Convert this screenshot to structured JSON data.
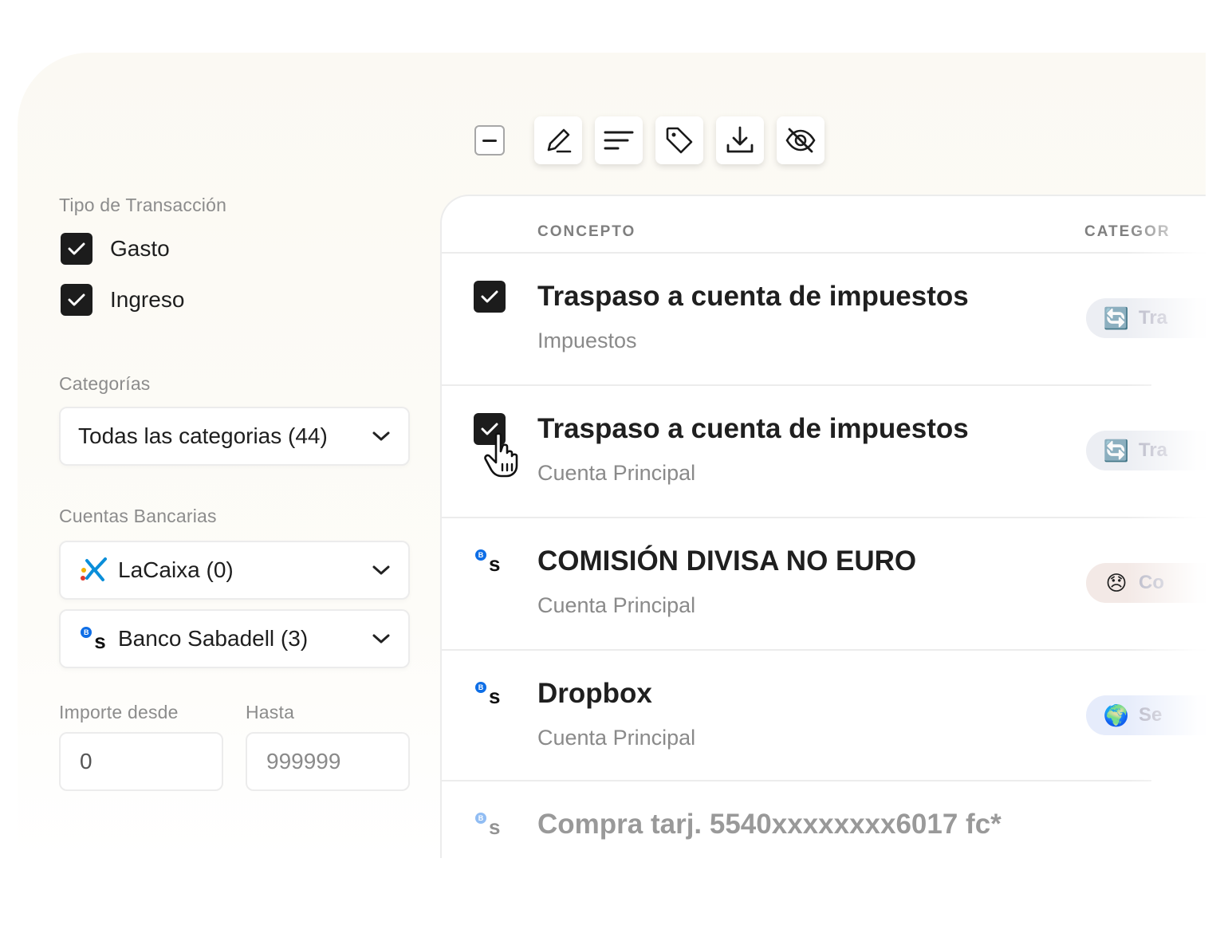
{
  "filters": {
    "transaction_type_label": "Tipo de Transacción",
    "types": [
      {
        "label": "Gasto",
        "checked": true
      },
      {
        "label": "Ingreso",
        "checked": true
      }
    ],
    "categories_label": "Categorías",
    "categories_value": "Todas las categorias (44)",
    "bank_accounts_label": "Cuentas Bancarias",
    "banks": [
      {
        "label": "LaCaixa (0)",
        "icon": "lacaixa-star-icon"
      },
      {
        "label": "Banco Sabadell (3)",
        "icon": "sabadell-bs-icon"
      }
    ],
    "amount_from_label": "Importe desde",
    "amount_to_label": "Hasta",
    "amount_from_value": "0",
    "amount_to_placeholder": "999999"
  },
  "toolbar": {
    "icons": [
      "minus-checkbox-icon",
      "edit-pen-icon",
      "sort-lines-icon",
      "tag-icon",
      "download-icon",
      "eye-off-icon"
    ]
  },
  "table": {
    "headers": {
      "concept": "CONCEPTO",
      "category": "CATEGOR"
    },
    "rows": [
      {
        "title": "Traspaso a cuenta de impuestos",
        "subtitle": "Impuestos",
        "checked": true,
        "category_emoji": "🔄",
        "category_text": "Tra",
        "pill_color": "#eceef3"
      },
      {
        "title": "Traspaso a cuenta de impuestos",
        "subtitle": "Cuenta Principal",
        "checked": true,
        "category_emoji": "🔄",
        "category_text": "Tra",
        "pill_color": "#eceef3"
      },
      {
        "title": "COMISIÓN DIVISA NO EURO",
        "subtitle": "Cuenta Principal",
        "checked": false,
        "category_emoji": "😞",
        "category_text": "Co",
        "pill_color": "#f3e9e6"
      },
      {
        "title": "Dropbox",
        "subtitle": "Cuenta Principal",
        "checked": false,
        "category_emoji": "🌍",
        "category_text": "Se",
        "pill_color": "#e6ecfb"
      },
      {
        "title": "Compra tarj. 5540xxxxxxxx6017 fc*",
        "subtitle": "",
        "checked": false
      }
    ]
  },
  "colors": {
    "accent": "#1c1c1c",
    "background": "#fbf9f3",
    "sabadell_blue": "#0e6ee6",
    "caixa_blue": "#0a8ed9"
  }
}
